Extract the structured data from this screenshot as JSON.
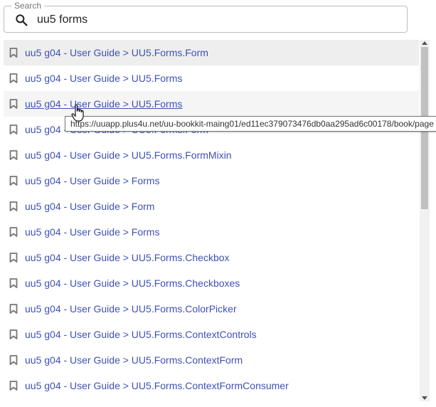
{
  "search": {
    "label": "Search",
    "value": "uu5 forms",
    "icon": "search-icon"
  },
  "results": [
    {
      "text": "uu5 g04 - User Guide > UU5.Forms.Form"
    },
    {
      "text": "uu5 g04 - User Guide > UU5.Forms"
    },
    {
      "text": "uu5 g04 - User Guide > UU5.Forms"
    },
    {
      "text": "uu5 g04 - User Guide > UU5.Forms.Form"
    },
    {
      "text": "uu5 g04 - User Guide > UU5.Forms.FormMixin"
    },
    {
      "text": "uu5 g04 - User Guide > Forms"
    },
    {
      "text": "uu5 g04 - User Guide > Form"
    },
    {
      "text": "uu5 g04 - User Guide > Forms"
    },
    {
      "text": "uu5 g04 - User Guide > UU5.Forms.Checkbox"
    },
    {
      "text": "uu5 g04 - User Guide > UU5.Forms.Checkboxes"
    },
    {
      "text": "uu5 g04 - User Guide > UU5.Forms.ColorPicker"
    },
    {
      "text": "uu5 g04 - User Guide > UU5.Forms.ContextControls"
    },
    {
      "text": "uu5 g04 - User Guide > UU5.Forms.ContextForm"
    },
    {
      "text": "uu5 g04 - User Guide > UU5.Forms.ContextFormConsumer"
    }
  ],
  "tooltip": {
    "text": "https://uuapp.plus4u.net/uu-bookkit-maing01/ed11ec379073476db0aa295ad6c00178/book/page"
  },
  "colors": {
    "link": "#3f51b5",
    "row_selected": "#eeeeee",
    "row_hover": "#f5f5f5"
  }
}
